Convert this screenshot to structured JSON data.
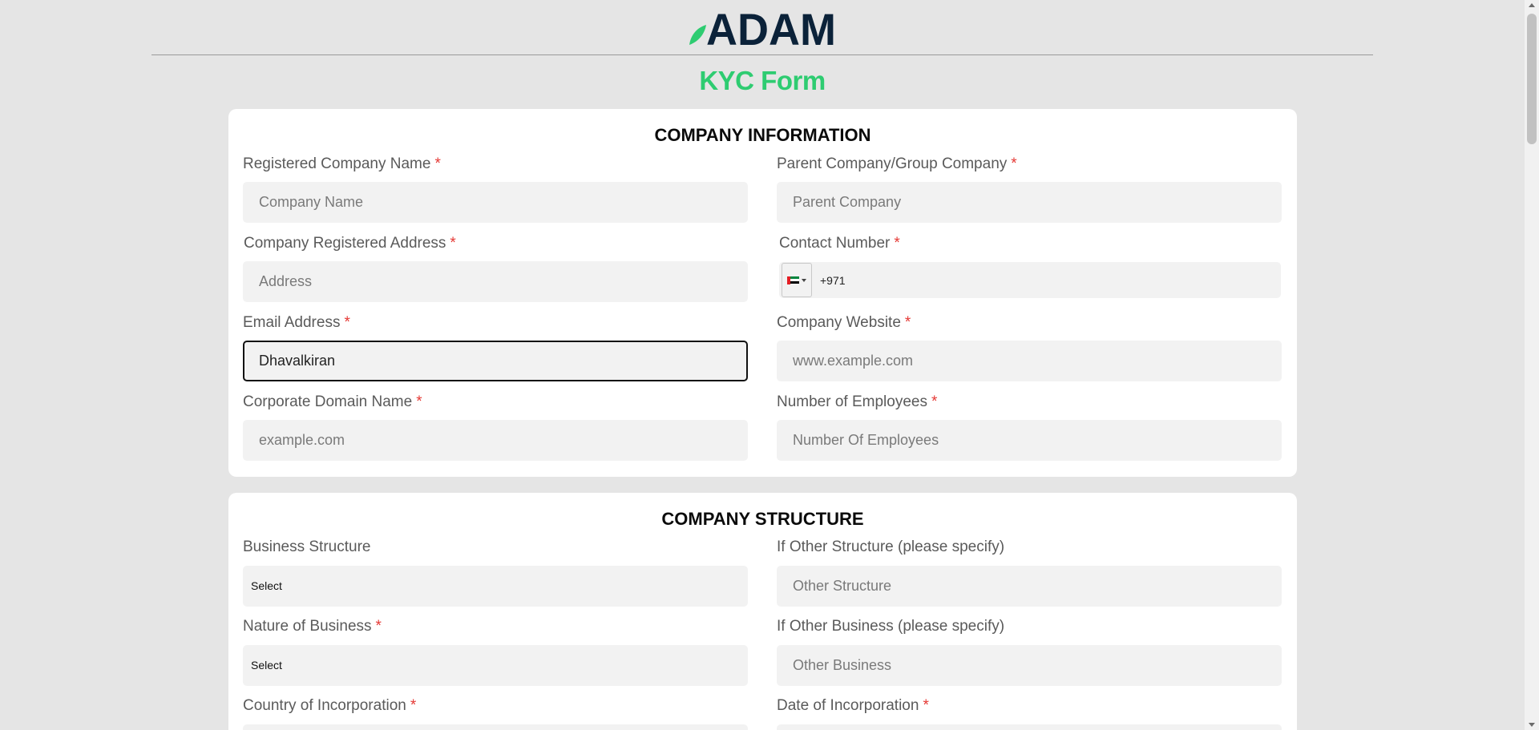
{
  "brand": {
    "logo_text": "ADAM",
    "logo_color": "#0b2239",
    "leaf_color": "#2ecc71"
  },
  "page_title": "KYC Form",
  "required_mark": "*",
  "company_information": {
    "title": "COMPANY INFORMATION",
    "registered_company_name": {
      "label": "Registered Company Name",
      "placeholder": "Company Name"
    },
    "parent_company": {
      "label": "Parent Company/Group Company",
      "placeholder": "Parent Company"
    },
    "registered_address": {
      "label": "Company Registered Address",
      "placeholder": "Address"
    },
    "contact_number": {
      "label": "Contact Number",
      "country_flag": "uae-flag-icon",
      "dial_code": "+971"
    },
    "email": {
      "label": "Email Address",
      "value": "Dhavalkiran"
    },
    "website": {
      "label": "Company Website",
      "placeholder": "www.example.com"
    },
    "domain": {
      "label": "Corporate Domain Name",
      "placeholder": "example.com"
    },
    "employees": {
      "label": "Number of Employees",
      "placeholder": "Number Of Employees"
    }
  },
  "company_structure": {
    "title": "COMPANY STRUCTURE",
    "business_structure": {
      "label": "Business Structure",
      "selected": "Select"
    },
    "other_structure": {
      "label": "If Other Structure (please specify)",
      "placeholder": "Other Structure"
    },
    "nature_of_business": {
      "label": "Nature of Business",
      "selected": "Select"
    },
    "other_business": {
      "label": "If Other Business (please specify)",
      "placeholder": "Other Business"
    },
    "country_of_incorporation": {
      "label": "Country of Incorporation"
    },
    "date_of_incorporation": {
      "label": "Date of Incorporation"
    }
  },
  "colors": {
    "accent_green": "#2ecc71",
    "required_red": "#e53935",
    "field_bg": "#f2f2f2",
    "page_bg": "#e5e5e5"
  }
}
